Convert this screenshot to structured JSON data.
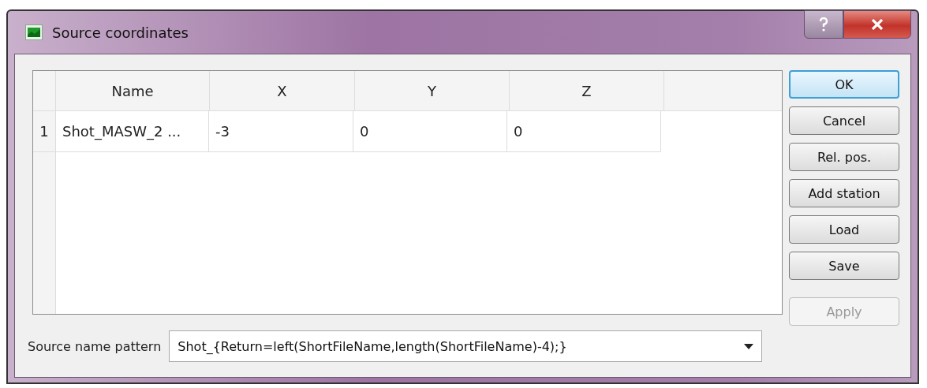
{
  "window": {
    "title": "Source coordinates"
  },
  "table": {
    "columns": [
      "Name",
      "X",
      "Y",
      "Z"
    ],
    "rows": [
      {
        "index": "1",
        "cells": [
          "Shot_MASW_2 ...",
          "-3",
          "0",
          "0"
        ]
      }
    ]
  },
  "buttons": [
    {
      "label": "OK",
      "default": true,
      "disabled": false
    },
    {
      "label": "Cancel",
      "default": false,
      "disabled": false
    },
    {
      "label": "Rel. pos.",
      "default": false,
      "disabled": false
    },
    {
      "label": "Add station",
      "default": false,
      "disabled": false
    },
    {
      "label": "Load",
      "default": false,
      "disabled": false
    },
    {
      "label": "Save",
      "default": false,
      "disabled": false
    }
  ],
  "pattern": {
    "label": "Source name pattern",
    "value": "Shot_{Return=left(ShortFileName,length(ShortFileName)-4);}"
  },
  "apply": {
    "label": "Apply",
    "disabled": true
  }
}
